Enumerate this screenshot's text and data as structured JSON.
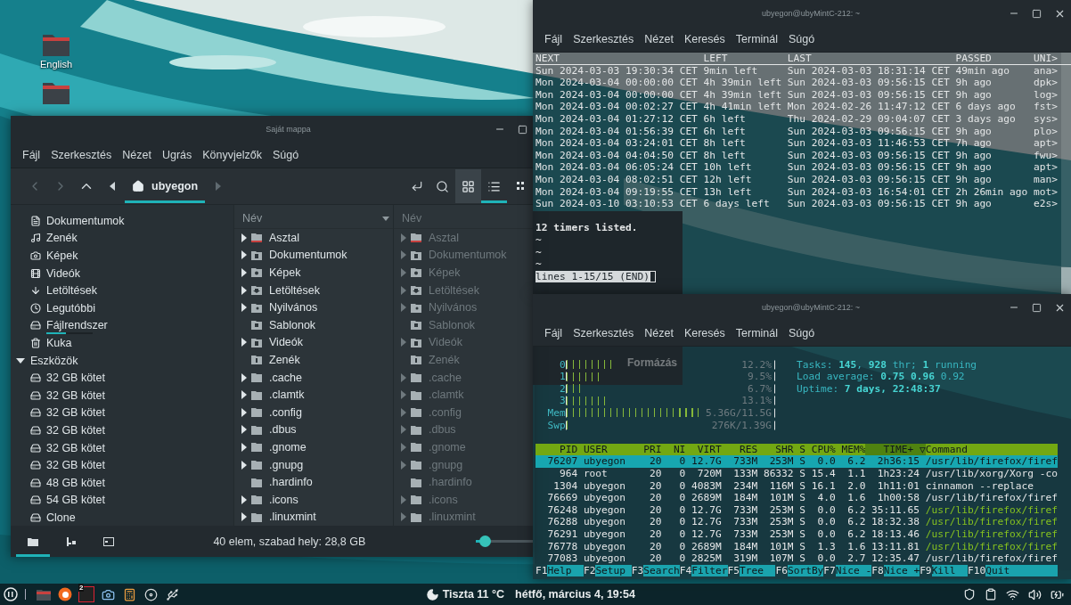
{
  "desktop": {
    "icons": [
      {
        "kind": "folder",
        "label": "English"
      },
      {
        "kind": "folder"
      }
    ],
    "background_window": {
      "label": "Formázás"
    }
  },
  "file_manager": {
    "title": "Saját mappa",
    "menu": [
      "Fájl",
      "Szerkesztés",
      "Nézet",
      "Ugrás",
      "Könyvjelzők",
      "Súgó"
    ],
    "toolbar": {
      "path": [
        {
          "label": "ubyegon",
          "selected": true
        }
      ],
      "views": [
        {
          "kind": "icons",
          "selected": false,
          "hovered": true
        },
        {
          "kind": "list",
          "selected": true,
          "hovered": false
        },
        {
          "kind": "compact",
          "selected": false,
          "hovered": false
        }
      ]
    },
    "sidebar": {
      "places": [
        {
          "label": "Dokumentumok",
          "kind": "documents"
        },
        {
          "label": "Zenék",
          "kind": "music"
        },
        {
          "label": "Képek",
          "kind": "pictures"
        },
        {
          "label": "Videók",
          "kind": "videos"
        },
        {
          "label": "Letöltések",
          "kind": "downloads"
        },
        {
          "label": "Legutóbbi",
          "kind": "recent"
        },
        {
          "label": "Fájlrendszer",
          "kind": "filesystem",
          "level": 0.42
        },
        {
          "label": "Kuka",
          "kind": "trash"
        }
      ],
      "devices": {
        "label": "Eszközök",
        "expanded": true,
        "items": [
          "32 GB kötet",
          "32 GB kötet",
          "32 GB kötet",
          "32 GB kötet",
          "32 GB kötet",
          "32 GB kötet",
          "48 GB kötet",
          "54 GB kötet",
          "Clone"
        ]
      }
    },
    "panes": [
      {
        "active": true,
        "header": "Név",
        "sorted": true,
        "items": [
          {
            "name": "Asztal",
            "kind": "desktop",
            "expandable": true
          },
          {
            "name": "Dokumentumok",
            "kind": "documents",
            "expandable": true
          },
          {
            "name": "Képek",
            "kind": "pictures",
            "expandable": true
          },
          {
            "name": "Letöltések",
            "kind": "downloads",
            "expandable": true
          },
          {
            "name": "Nyilvános",
            "kind": "public",
            "expandable": true
          },
          {
            "name": "Sablonok",
            "kind": "templates",
            "expandable": false
          },
          {
            "name": "Videók",
            "kind": "videos",
            "expandable": true
          },
          {
            "name": "Zenék",
            "kind": "music",
            "expandable": false
          },
          {
            "name": ".cache",
            "kind": "folder",
            "expandable": true
          },
          {
            "name": ".clamtk",
            "kind": "folder",
            "expandable": true
          },
          {
            "name": ".config",
            "kind": "folder",
            "expandable": true
          },
          {
            "name": ".dbus",
            "kind": "folder",
            "expandable": true
          },
          {
            "name": ".gnome",
            "kind": "folder",
            "expandable": true
          },
          {
            "name": ".gnupg",
            "kind": "folder",
            "expandable": true
          },
          {
            "name": ".hardinfo",
            "kind": "folder",
            "expandable": false
          },
          {
            "name": ".icons",
            "kind": "folder",
            "expandable": true
          },
          {
            "name": ".linuxmint",
            "kind": "folder",
            "expandable": true
          }
        ]
      },
      {
        "active": false,
        "header": "Név",
        "sorted": false,
        "items": [
          {
            "name": "Asztal",
            "kind": "desktop",
            "expandable": true
          },
          {
            "name": "Dokumentumok",
            "kind": "documents",
            "expandable": true
          },
          {
            "name": "Képek",
            "kind": "pictures",
            "expandable": true
          },
          {
            "name": "Letöltések",
            "kind": "downloads",
            "expandable": true
          },
          {
            "name": "Nyilvános",
            "kind": "public",
            "expandable": true
          },
          {
            "name": "Sablonok",
            "kind": "templates",
            "expandable": false
          },
          {
            "name": "Videók",
            "kind": "videos",
            "expandable": true
          },
          {
            "name": "Zenék",
            "kind": "music",
            "expandable": false
          },
          {
            "name": ".cache",
            "kind": "folder",
            "expandable": true
          },
          {
            "name": ".clamtk",
            "kind": "folder",
            "expandable": true
          },
          {
            "name": ".config",
            "kind": "folder",
            "expandable": true
          },
          {
            "name": ".dbus",
            "kind": "folder",
            "expandable": true
          },
          {
            "name": ".gnome",
            "kind": "folder",
            "expandable": true
          },
          {
            "name": ".gnupg",
            "kind": "folder",
            "expandable": true
          },
          {
            "name": ".hardinfo",
            "kind": "folder",
            "expandable": false
          },
          {
            "name": ".icons",
            "kind": "folder",
            "expandable": true
          },
          {
            "name": ".linuxmint",
            "kind": "folder",
            "expandable": true
          }
        ]
      }
    ],
    "status": {
      "tabs": [
        {
          "kind": "places",
          "selected": true
        },
        {
          "kind": "tree",
          "selected": false
        },
        {
          "kind": "hide",
          "selected": false
        }
      ],
      "text": "40 elem, szabad hely: 28,8 GB",
      "zoom": {
        "level": 0.15
      }
    }
  },
  "timers_terminal": {
    "title": "ubyegon@ubyMintC-212: ~",
    "menu": [
      "Fájl",
      "Szerkesztés",
      "Nézet",
      "Keresés",
      "Terminál",
      "Súgó"
    ],
    "columns": [
      "NEXT",
      "LEFT",
      "LAST",
      "PASSED",
      "UNI>"
    ],
    "rows": [
      [
        "Sun 2024-03-03 19:30:34 CET",
        "9min left",
        "Sun 2024-03-03 18:31:14 CET",
        "49min ago",
        "ana>"
      ],
      [
        "Mon 2024-03-04 00:00:00 CET",
        "4h 39min left",
        "Sun 2024-03-03 09:56:15 CET",
        "9h ago",
        "dpk>"
      ],
      [
        "Mon 2024-03-04 00:00:00 CET",
        "4h 39min left",
        "Sun 2024-03-03 09:56:15 CET",
        "9h ago",
        "log>"
      ],
      [
        "Mon 2024-03-04 00:02:27 CET",
        "4h 41min left",
        "Mon 2024-02-26 11:47:12 CET",
        "6 days ago",
        "fst>"
      ],
      [
        "Mon 2024-03-04 01:27:12 CET",
        "6h left",
        "Thu 2024-02-29 09:04:07 CET",
        "3 days ago",
        "sys>"
      ],
      [
        "Mon 2024-03-04 01:56:39 CET",
        "6h left",
        "Sun 2024-03-03 09:56:15 CET",
        "9h ago",
        "plo>"
      ],
      [
        "Mon 2024-03-04 03:24:01 CET",
        "8h left",
        "Sun 2024-03-03 11:46:53 CET",
        "7h ago",
        "apt>"
      ],
      [
        "Mon 2024-03-04 04:04:50 CET",
        "8h left",
        "Sun 2024-03-03 09:56:15 CET",
        "9h ago",
        "fwu>"
      ],
      [
        "Mon 2024-03-04 06:05:24 CET",
        "10h left",
        "Sun 2024-03-03 09:56:15 CET",
        "9h ago",
        "apt>"
      ],
      [
        "Mon 2024-03-04 08:02:51 CET",
        "12h left",
        "Sun 2024-03-03 09:56:15 CET",
        "9h ago",
        "man>"
      ],
      [
        "Mon 2024-03-04 09:19:55 CET",
        "13h left",
        "Sun 2024-03-03 16:54:01 CET",
        "2h 26min ago",
        "mot>"
      ],
      [
        "Sun 2024-03-10 03:10:53 CET",
        "6 days left",
        "Sun 2024-03-03 09:56:15 CET",
        "9h ago",
        "e2s>"
      ]
    ],
    "summary": "12 timers listed.",
    "tildes": [
      "~",
      "~",
      "~"
    ],
    "prompt": "lines 1-15/15 (END)"
  },
  "htop_terminal": {
    "title": "ubyegon@ubyMintC-212: ~",
    "menu": [
      "Fájl",
      "Szerkesztés",
      "Nézet",
      "Keresés",
      "Terminál",
      "Súgó"
    ],
    "meters": [
      {
        "label": "0",
        "level": 0.24,
        "reading": "12.2%"
      },
      {
        "label": "1",
        "level": 0.16,
        "reading": "9.5%"
      },
      {
        "label": "2",
        "level": 0.09,
        "reading": "6.7%"
      },
      {
        "label": "3",
        "level": 0.19,
        "reading": "13.1%"
      },
      {
        "label": "Mem",
        "level": 0.66,
        "reading": "5.36G/11.5G"
      },
      {
        "label": "Swp",
        "level": 0.02,
        "reading": "276K/1.39G"
      }
    ],
    "info": [
      "Tasks: **145**, **928** thr; **1** running",
      "Load average: **0.75** **0.96** 0.92",
      "Uptime: **7 days, 22:48:37**"
    ],
    "columns": [
      {
        "label": "PID",
        "sorted": false
      },
      {
        "label": "USER",
        "sorted": false
      },
      {
        "label": "PRI",
        "sorted": false
      },
      {
        "label": "NI",
        "sorted": false
      },
      {
        "label": "VIRT",
        "sorted": false
      },
      {
        "label": "RES",
        "sorted": false
      },
      {
        "label": "SHR",
        "sorted": false
      },
      {
        "label": "S",
        "sorted": false
      },
      {
        "label": "CPU%",
        "sorted": false
      },
      {
        "label": "MEM%",
        "sorted": false
      },
      {
        "label": "TIME+ ▽",
        "sorted": true
      },
      {
        "label": "Command",
        "sorted": false
      }
    ],
    "processes": [
      {
        "cells": [
          "76207",
          "ubyegon",
          "20",
          "0",
          "12.7G",
          "733M",
          "253M",
          "S",
          "0.0",
          "6.2",
          "2h36:15",
          "/usr/lib/firefox/firef"
        ],
        "selected": true,
        "thread": false
      },
      {
        "cells": [
          "964",
          "root",
          "20",
          "0",
          "720M",
          "133M",
          "86332",
          "S",
          "15.4",
          "1.1",
          "1h23:24",
          "/usr/lib/xorg/Xorg -co"
        ],
        "selected": false,
        "thread": false
      },
      {
        "cells": [
          "1304",
          "ubyegon",
          "20",
          "0",
          "4083M",
          "234M",
          "116M",
          "S",
          "16.1",
          "2.0",
          "1h11:01",
          "cinnamon --replace"
        ],
        "selected": false,
        "thread": false
      },
      {
        "cells": [
          "76669",
          "ubyegon",
          "20",
          "0",
          "2689M",
          "184M",
          "101M",
          "S",
          "4.0",
          "1.6",
          "1h00:58",
          "/usr/lib/firefox/firef"
        ],
        "selected": false,
        "thread": false
      },
      {
        "cells": [
          "76248",
          "ubyegon",
          "20",
          "0",
          "12.7G",
          "733M",
          "253M",
          "S",
          "0.0",
          "6.2",
          "35:11.65",
          "/usr/lib/firefox/firef"
        ],
        "selected": false,
        "thread": true
      },
      {
        "cells": [
          "76288",
          "ubyegon",
          "20",
          "0",
          "12.7G",
          "733M",
          "253M",
          "S",
          "0.0",
          "6.2",
          "18:32.38",
          "/usr/lib/firefox/firef"
        ],
        "selected": false,
        "thread": true
      },
      {
        "cells": [
          "76291",
          "ubyegon",
          "20",
          "0",
          "12.7G",
          "733M",
          "253M",
          "S",
          "0.0",
          "6.2",
          "18:13.46",
          "/usr/lib/firefox/firef"
        ],
        "selected": false,
        "thread": true
      },
      {
        "cells": [
          "76778",
          "ubyegon",
          "20",
          "0",
          "2689M",
          "184M",
          "101M",
          "S",
          "1.3",
          "1.6",
          "13:11.81",
          "/usr/lib/firefox/firef"
        ],
        "selected": false,
        "thread": true
      },
      {
        "cells": [
          "77083",
          "ubyegon",
          "20",
          "0",
          "2825M",
          "319M",
          "107M",
          "S",
          "0.0",
          "2.7",
          "12:35.47",
          "/usr/lib/firefox/firef"
        ],
        "selected": false,
        "thread": false
      }
    ],
    "keys": [
      {
        "key": "F1",
        "label": "Help"
      },
      {
        "key": "F2",
        "label": "Setup"
      },
      {
        "key": "F3",
        "label": "Search"
      },
      {
        "key": "F4",
        "label": "Filter"
      },
      {
        "key": "F5",
        "label": "Tree"
      },
      {
        "key": "F6",
        "label": "SortBy"
      },
      {
        "key": "F7",
        "label": "Nice -"
      },
      {
        "key": "F8",
        "label": "Nice +"
      },
      {
        "key": "F9",
        "label": "Kill"
      },
      {
        "key": "F10",
        "label": "Quit"
      }
    ]
  },
  "taskbar": {
    "apps": [
      {
        "kind": "files"
      },
      {
        "kind": "firefox"
      },
      {
        "kind": "terminal",
        "badge": "2"
      },
      {
        "kind": "screenshot"
      },
      {
        "kind": "calculator"
      },
      {
        "kind": "disks"
      },
      {
        "kind": "usb"
      }
    ],
    "weather": "Tiszta 11 °C",
    "clock": "hétfő, március 4, 19:54",
    "tray": [
      {
        "kind": "update"
      },
      {
        "kind": "clipboard"
      },
      {
        "kind": "wifi"
      },
      {
        "kind": "volume"
      },
      {
        "kind": "power"
      }
    ]
  }
}
